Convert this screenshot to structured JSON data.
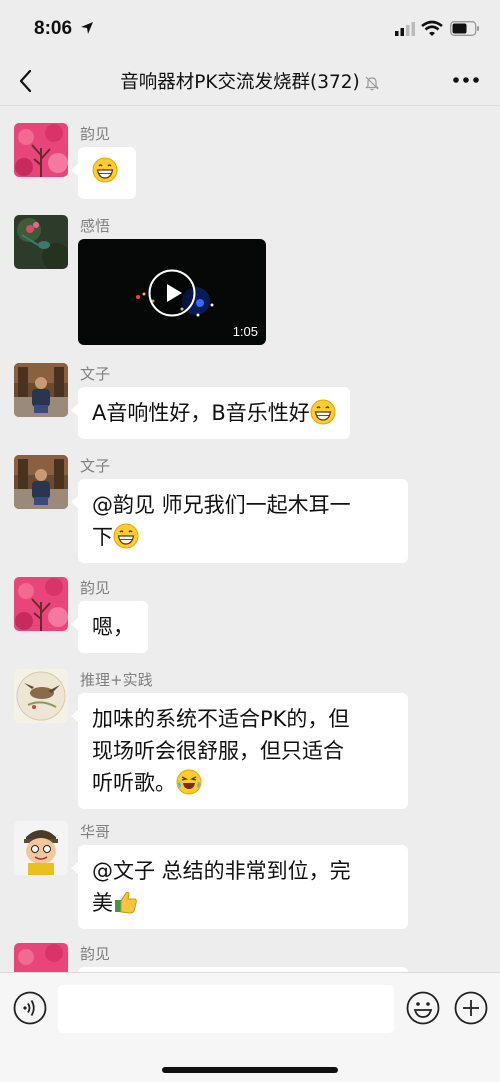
{
  "status": {
    "time": "8:06"
  },
  "nav": {
    "title": "音响器材PK交流发烧群(372)"
  },
  "messages": [
    {
      "sender": "韵见",
      "type": "emoji"
    },
    {
      "sender": "感悟",
      "type": "video",
      "duration": "1:05"
    },
    {
      "sender": "文子",
      "text": "A音响性好，B音乐性好"
    },
    {
      "sender": "文子",
      "line1": "@韵见 师兄我们一起木耳一",
      "line2": "下"
    },
    {
      "sender": "韵见",
      "text": "嗯，"
    },
    {
      "sender": "推理+实践",
      "line1": "加味的系统不适合PK的，但",
      "line2": "现场听会很舒服，但只适合",
      "line3": "听听歌。"
    },
    {
      "sender": "华哥",
      "line1": "@文子 总结的非常到位，完",
      "line2": "美"
    },
    {
      "sender": "韵见"
    }
  ],
  "input": {
    "placeholder": ""
  },
  "colors": {
    "background": "#ededed",
    "bubble": "#ffffff",
    "sender": "#808080"
  }
}
